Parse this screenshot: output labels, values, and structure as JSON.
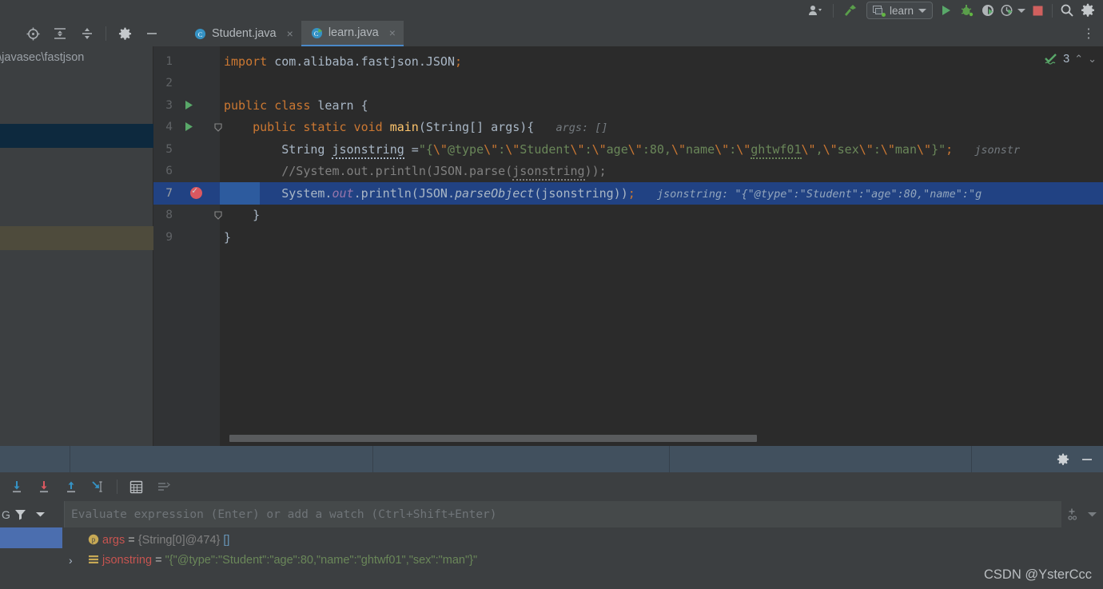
{
  "toolbar": {
    "icons": [
      "user-avatar-icon",
      "hammer-build-icon"
    ],
    "run_config": {
      "label": "learn",
      "icon": "run-config-icon"
    },
    "actions": [
      {
        "name": "run-button",
        "label": "Run"
      },
      {
        "name": "debug-button",
        "label": "Debug"
      },
      {
        "name": "run-coverage-button",
        "label": "Run with Coverage"
      },
      {
        "name": "profiler-button",
        "label": "Profiler"
      },
      {
        "name": "stop-button",
        "label": "Stop"
      },
      {
        "name": "search-everywhere-button",
        "label": "Search"
      },
      {
        "name": "settings-button",
        "label": "Settings"
      }
    ]
  },
  "tabbar": {
    "left_icons": [
      "locate-icon",
      "expand-all-icon",
      "collapse-all-icon",
      "gear-icon",
      "minimize-icon"
    ],
    "tabs": [
      {
        "label": "Student.java",
        "icon": "java-class-icon",
        "active": false,
        "close": "×"
      },
      {
        "label": "learn.java",
        "icon": "java-run-class-icon",
        "active": true,
        "close": "×"
      }
    ],
    "overflow": "⋮"
  },
  "project_panel": {
    "path_fragment": "op\\javasec\\fastjson"
  },
  "editor": {
    "inspection": {
      "count": "3",
      "icon": "inspection-ok-icon",
      "up": "⌃",
      "down": "⌄"
    },
    "lines": [
      {
        "n": "1",
        "code_html": "<span class=\"kw\">import</span> <span class=\"plain\">com.alibaba.fastjson.JSON</span><span class=\"kw\">;</span>",
        "text": "import com.alibaba.fastjson.JSON;"
      },
      {
        "n": "2",
        "code_html": "",
        "text": ""
      },
      {
        "n": "3",
        "code_html": "<span class=\"kw\">public class</span> <span class=\"plain\">learn {</span>",
        "text": "public class learn {",
        "run_marker": true
      },
      {
        "n": "4",
        "code_html": "<span class=\"plain\">    </span><span class=\"kw\">public static void</span> <span class=\"mname\">main</span><span class=\"plain\">(String[] args){</span>   <span class=\"hint\">args: []</span>",
        "text": "    public static void main(String[] args){   args: []",
        "run_marker": true,
        "fold": true
      },
      {
        "n": "5",
        "code_html": "<span class=\"plain\">        String </span><span class=\"plain squig3\">jsonstring</span><span class=\"plain\"> =</span><span class=\"str\">\"{</span><span class=\"esc\">\\\"</span><span class=\"str\">@type</span><span class=\"esc\">\\\"</span><span class=\"str\">:</span><span class=\"esc\">\\\"</span><span class=\"str\">Student</span><span class=\"esc\">\\\"</span><span class=\"str\">:</span><span class=\"esc\">\\\"</span><span class=\"str\">age</span><span class=\"esc\">\\\"</span><span class=\"str\">:80,</span><span class=\"esc\">\\\"</span><span class=\"str\">name</span><span class=\"esc\">\\\"</span><span class=\"str\">:</span><span class=\"esc\">\\\"</span><span class=\"str squig\">ghtwf01</span><span class=\"esc\">\\\"</span><span class=\"str\">,</span><span class=\"esc\">\\\"</span><span class=\"str\">sex</span><span class=\"esc\">\\\"</span><span class=\"str\">:</span><span class=\"esc\">\\\"</span><span class=\"str\">man</span><span class=\"esc\">\\\"</span><span class=\"str\">}\"</span><span class=\"kw\">;</span>   <span class=\"hint\">jsonstr</span>",
        "text": "        String jsonstring =\"{\\\"@type\\\":\\\"Student\\\":\\\"age\\\":80,\\\"name\\\":\\\"ghtwf01\\\",\\\"sex\\\":\\\"man\\\"}\";   jsonstring:"
      },
      {
        "n": "6",
        "code_html": "<span class=\"cmt\">        //System.out.println(JSON.parse(</span><span class=\"cmt squig2\">jsonstring</span><span class=\"cmt\">));</span>",
        "text": "        //System.out.println(JSON.parse(jsonstring));"
      },
      {
        "n": "7",
        "code_html": "<span class=\"plain\">        System.</span><span class=\"fld\">out</span><span class=\"plain\">.println(JSON.</span><span class=\"mth\">parseObject</span><span class=\"plain\">(jsonstring))</span><span class=\"kw\">;</span>   <span class=\"hint2\">jsonstring: \"{\"@type\":\"Student\":\"age\":80,\"name\":\"g</span>",
        "text": "        System.out.println(JSON.parseObject(jsonstring));   jsonstring: \"{\"@type\":\"Student\":\"age\":80,\"name\":\"g",
        "highlight": true,
        "breakpoint": true
      },
      {
        "n": "8",
        "code_html": "<span class=\"plain\">    }</span>",
        "text": "    }",
        "fold": true
      },
      {
        "n": "9",
        "code_html": "<span class=\"plain\">}</span>",
        "text": "}"
      }
    ]
  },
  "debugger": {
    "tools": [
      {
        "name": "step-over-button",
        "label": "Step Over"
      },
      {
        "name": "step-into-button",
        "label": "Step Into"
      },
      {
        "name": "step-out-button",
        "label": "Step Out"
      },
      {
        "name": "run-to-cursor-button",
        "label": "Run to Cursor"
      },
      {
        "name": "evaluate-expression-button",
        "label": "Evaluate Expression"
      },
      {
        "name": "mute-breakpoints-button",
        "label": "Mute Breakpoints"
      }
    ],
    "header_icons": [
      "settings-gear-icon",
      "minimize-icon",
      "layout-icon"
    ],
    "filter_label": "G",
    "evaluate": {
      "placeholder": "Evaluate expression (Enter) or add a watch (Ctrl+Shift+Enter)",
      "value": ""
    },
    "add_watch_icon": "add-watch-icon",
    "variables": [
      {
        "expand": "",
        "icon": "parameter-icon",
        "name": "args",
        "eq": " = ",
        "type": "{String[0]@474}",
        "value": "[]",
        "value_class": "vbr"
      },
      {
        "expand": "›",
        "icon": "local-variable-icon",
        "name": "jsonstring",
        "eq": " = ",
        "type": "",
        "value": "\"{\"@type\":\"Student\":\"age\":80,\"name\":\"ghtwf01\",\"sex\":\"man\"}\"",
        "value_class": "vstr"
      }
    ]
  },
  "watermark": "CSDN @YsterCcc",
  "colors": {
    "editor_bg": "#2b2b2b",
    "panel_bg": "#3c3f41",
    "gutter_bg": "#313335",
    "selection_blue": "#214283",
    "accent_blue": "#4b6eaf",
    "string_green": "#6a8759",
    "keyword_orange": "#cc7832",
    "breakpoint_red": "#db5860",
    "run_green": "#62b543"
  }
}
